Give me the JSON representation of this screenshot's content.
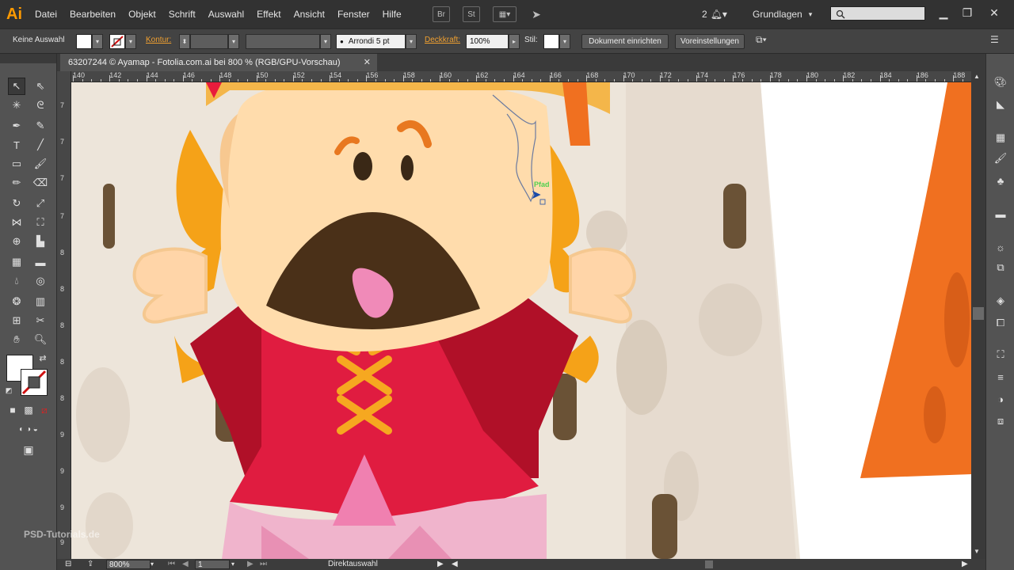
{
  "app": {
    "logo": "Ai"
  },
  "menu": [
    "Datei",
    "Bearbeiten",
    "Objekt",
    "Schrift",
    "Auswahl",
    "Effekt",
    "Ansicht",
    "Fenster",
    "Hilfe"
  ],
  "menubar_icons": {
    "br": "Br",
    "st": "St"
  },
  "notifications": {
    "count": "2"
  },
  "workspace": {
    "label": "Grundlagen"
  },
  "search": {
    "placeholder": ""
  },
  "control": {
    "selection": "Keine Auswahl",
    "stroke_label": "Kontur:",
    "brush": "Arrondi 5 pt",
    "opacity_label": "Deckkraft:",
    "opacity": "100%",
    "style_label": "Stil:",
    "doc_setup": "Dokument einrichten",
    "preferences": "Voreinstellungen"
  },
  "document": {
    "tab_title": "63207244 © Ayamap - Fotolia.com.ai bei 800 % (RGB/GPU-Vorschau)"
  },
  "ruler_h": [
    "140",
    "142",
    "144",
    "146",
    "148",
    "150",
    "152",
    "154",
    "156",
    "158",
    "160",
    "162",
    "164",
    "166",
    "168",
    "170",
    "172",
    "174",
    "176",
    "178",
    "180",
    "182",
    "184",
    "186",
    "188"
  ],
  "ruler_v": [
    "7",
    "7",
    "7",
    "7",
    "8",
    "8",
    "8",
    "8",
    "8",
    "9",
    "9",
    "9",
    "9"
  ],
  "cursor_hint": "Pfad",
  "status": {
    "zoom": "800%",
    "artboard": "1",
    "tool": "Direktauswahl"
  },
  "watermark": "PSD-Tutorials.de",
  "colors": {
    "accent_orange": "#f0a030",
    "ui_dark": "#323232",
    "ui_mid": "#535353"
  }
}
